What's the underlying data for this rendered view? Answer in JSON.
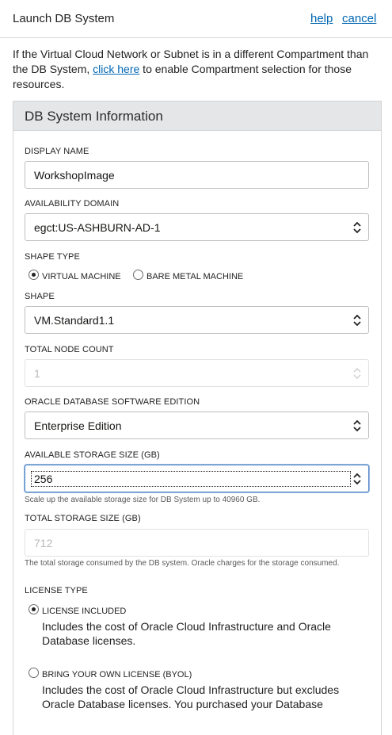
{
  "header": {
    "title": "Launch DB System",
    "help_label": "help",
    "cancel_label": "cancel"
  },
  "intro": {
    "before_link": "If the Virtual Cloud Network or Subnet is in a different Compartment than the DB System, ",
    "link_text": "click here",
    "after_link": " to enable Compartment selection for those resources."
  },
  "section": {
    "title": "DB System Information"
  },
  "display_name": {
    "label": "DISPLAY NAME",
    "value": "WorkshopImage"
  },
  "availability_domain": {
    "label": "AVAILABILITY DOMAIN",
    "value": "egct:US-ASHBURN-AD-1"
  },
  "shape_type": {
    "label": "SHAPE TYPE",
    "options": [
      {
        "label": "VIRTUAL MACHINE",
        "selected": true
      },
      {
        "label": "BARE METAL MACHINE",
        "selected": false
      }
    ]
  },
  "shape": {
    "label": "SHAPE",
    "value": "VM.Standard1.1"
  },
  "node_count": {
    "label": "TOTAL NODE COUNT",
    "value": "1"
  },
  "software_edition": {
    "label": "ORACLE DATABASE SOFTWARE EDITION",
    "value": "Enterprise Edition"
  },
  "available_storage": {
    "label": "AVAILABLE STORAGE SIZE (GB)",
    "value": "256",
    "help": "Scale up the available storage size for DB System up to 40960 GB."
  },
  "total_storage": {
    "label": "TOTAL STORAGE SIZE (GB)",
    "value": "712",
    "help": "The total storage consumed by the DB system. Oracle charges for the storage consumed."
  },
  "license_type": {
    "label": "LICENSE TYPE",
    "options": [
      {
        "label": "LICENSE INCLUDED",
        "description": "Includes the cost of Oracle Cloud Infrastructure and Oracle Database licenses.",
        "selected": true
      },
      {
        "label": "BRING YOUR OWN LICENSE (BYOL)",
        "description": "Includes the cost of Oracle Cloud Infrastructure but excludes Oracle Database licenses. You purchased your Database",
        "selected": false
      }
    ]
  },
  "colors": {
    "link": "#0066b3",
    "panel_header": "#e4e6e8",
    "focus_ring": "#5b8cc7"
  }
}
